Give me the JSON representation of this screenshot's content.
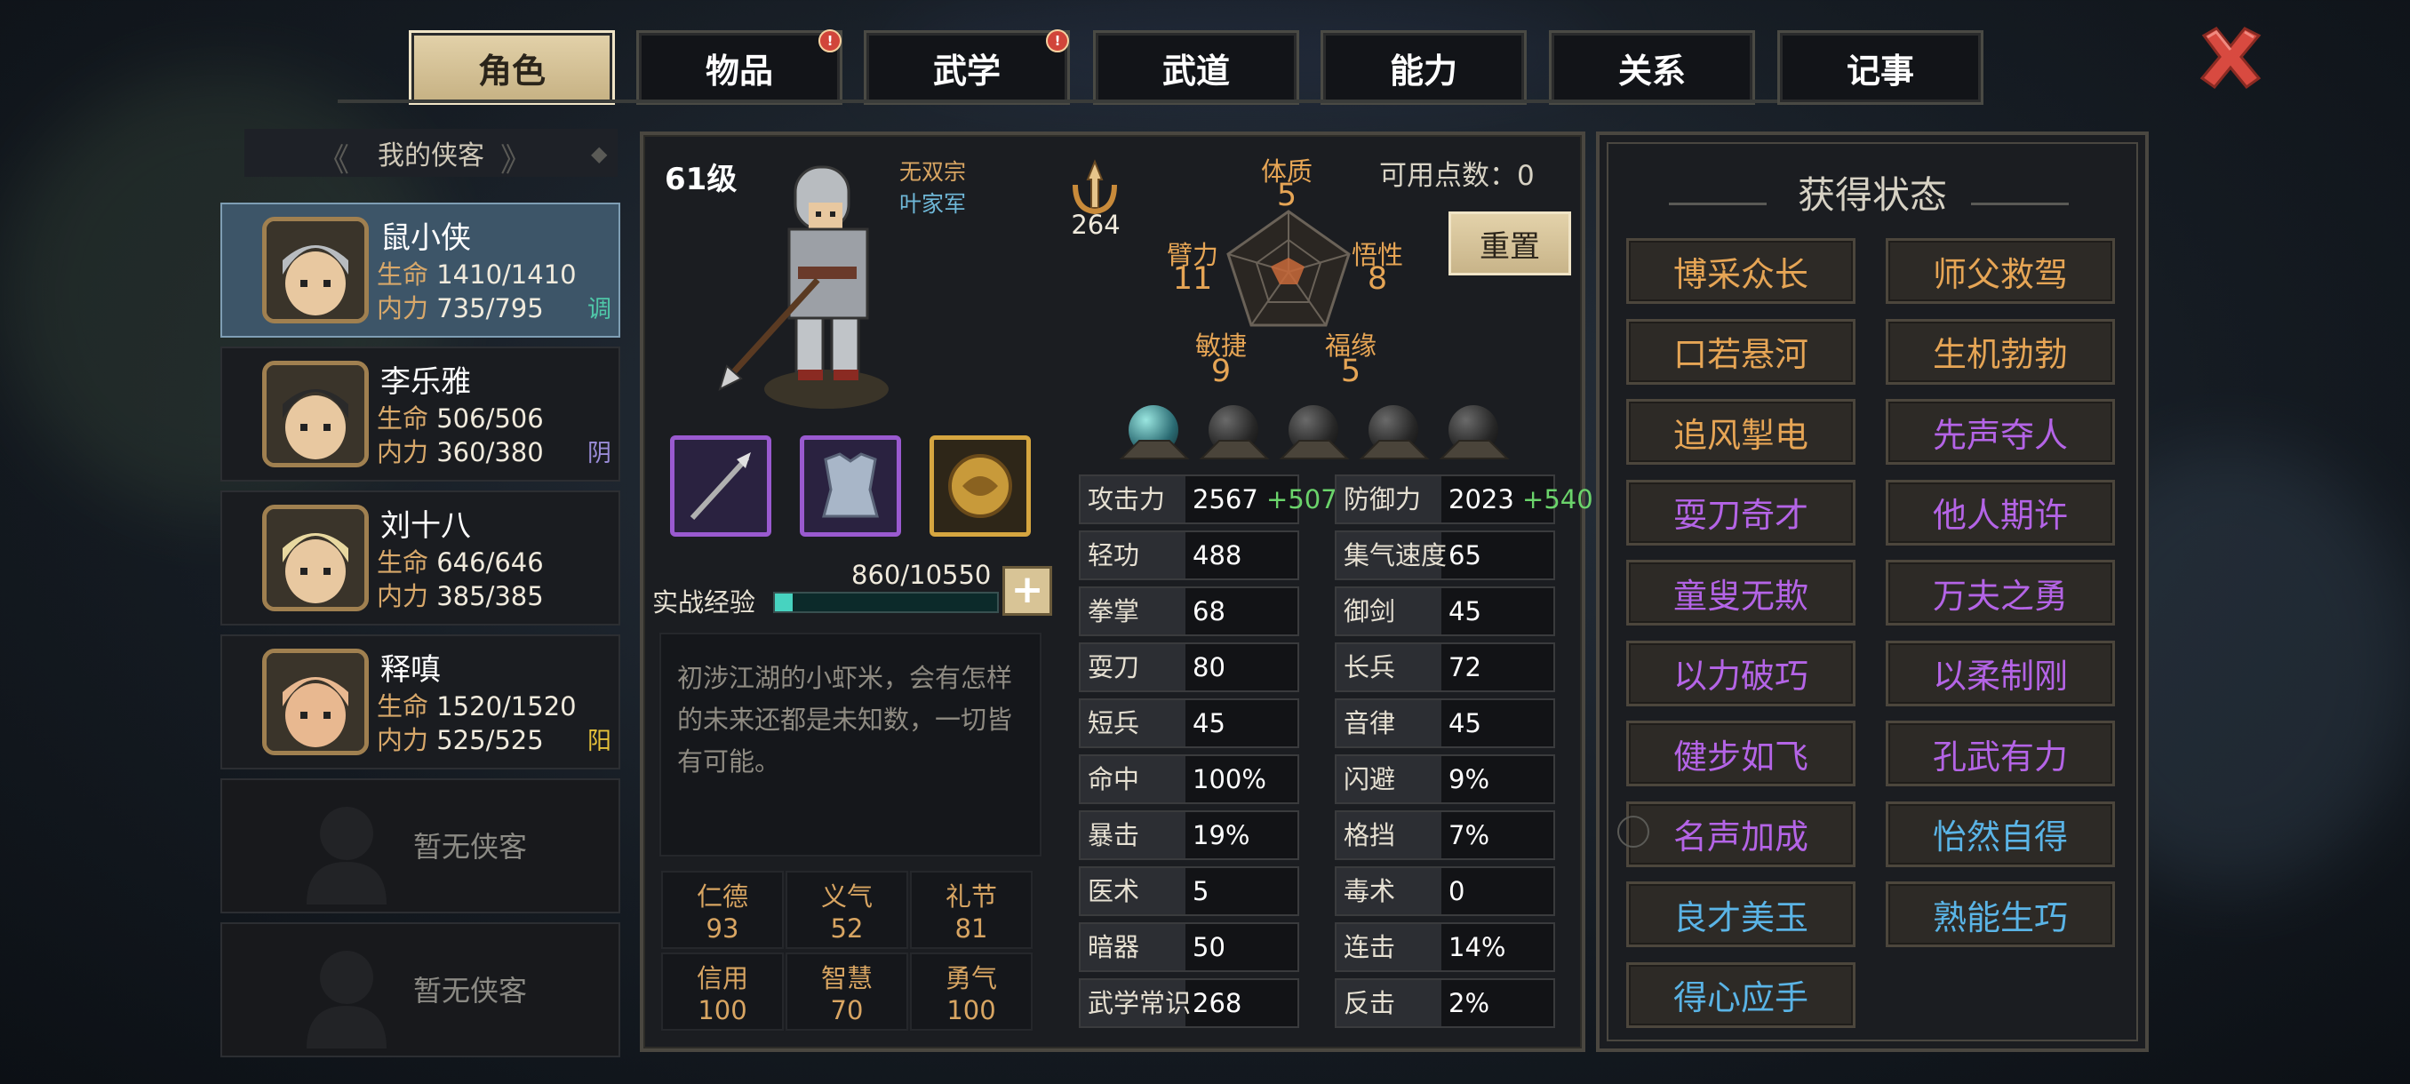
{
  "tabs": [
    {
      "label": "角色",
      "active": true,
      "badge": false
    },
    {
      "label": "物品",
      "active": false,
      "badge": true
    },
    {
      "label": "武学",
      "active": false,
      "badge": true
    },
    {
      "label": "武道",
      "active": false,
      "badge": false
    },
    {
      "label": "能力",
      "active": false,
      "badge": false
    },
    {
      "label": "关系",
      "active": false,
      "badge": false
    },
    {
      "label": "记事",
      "active": false,
      "badge": false
    }
  ],
  "badge_glyph": "!",
  "list_title": "我的侠客",
  "heroes": [
    {
      "name": "鼠小侠",
      "hp_label": "生命",
      "hp": "1410/1410",
      "mp_label": "内力",
      "mp": "735/795",
      "tag": "调",
      "tag_color": "#4fc7a8"
    },
    {
      "name": "李乐雅",
      "hp_label": "生命",
      "hp": "506/506",
      "mp_label": "内力",
      "mp": "360/380",
      "tag": "阴",
      "tag_color": "#9a8cd8"
    },
    {
      "name": "刘十八",
      "hp_label": "生命",
      "hp": "646/646",
      "mp_label": "内力",
      "mp": "385/385",
      "tag": "",
      "tag_color": "#ffffff"
    },
    {
      "name": "释嗔",
      "hp_label": "生命",
      "hp": "1520/1520",
      "mp_label": "内力",
      "mp": "525/525",
      "tag": "阳",
      "tag_color": "#e6c23a"
    }
  ],
  "empty_slots": [
    "暂无侠客",
    "暂无侠客"
  ],
  "character": {
    "level": "61级",
    "sect": "无双宗",
    "army": "叶家军",
    "power": "264",
    "available_points": "可用点数：0",
    "reset_label": "重置",
    "attributes": {
      "tizhi": {
        "name": "体质",
        "value": "5"
      },
      "bili": {
        "name": "臂力",
        "value": "11"
      },
      "wuxing": {
        "name": "悟性",
        "value": "8"
      },
      "minjie": {
        "name": "敏捷",
        "value": "9"
      },
      "fuyuan": {
        "name": "福缘",
        "value": "5"
      }
    },
    "exp_label": "实战经验",
    "exp_value": "860/10550",
    "exp_fraction": 0.0815,
    "exp_plus": "+",
    "description": "初涉江湖的小虾米，会有怎样的未来还都是未知数，一切皆有可能。",
    "virtues": [
      {
        "name": "仁德",
        "value": "93"
      },
      {
        "name": "义气",
        "value": "52"
      },
      {
        "name": "礼节",
        "value": "81"
      },
      {
        "name": "信用",
        "value": "100"
      },
      {
        "name": "智慧",
        "value": "70"
      },
      {
        "name": "勇气",
        "value": "100"
      }
    ]
  },
  "stats": [
    {
      "name": "攻击力",
      "value": "2567",
      "bonus": "+507"
    },
    {
      "name": "防御力",
      "value": "2023",
      "bonus": "+540"
    },
    {
      "name": "轻功",
      "value": "488",
      "bonus": ""
    },
    {
      "name": "集气速度",
      "value": "65",
      "bonus": ""
    },
    {
      "name": "拳掌",
      "value": "68",
      "bonus": ""
    },
    {
      "name": "御剑",
      "value": "45",
      "bonus": ""
    },
    {
      "name": "耍刀",
      "value": "80",
      "bonus": ""
    },
    {
      "name": "长兵",
      "value": "72",
      "bonus": ""
    },
    {
      "name": "短兵",
      "value": "45",
      "bonus": ""
    },
    {
      "name": "音律",
      "value": "45",
      "bonus": ""
    },
    {
      "name": "命中",
      "value": "100%",
      "bonus": ""
    },
    {
      "name": "闪避",
      "value": "9%",
      "bonus": ""
    },
    {
      "name": "暴击",
      "value": "19%",
      "bonus": ""
    },
    {
      "name": "格挡",
      "value": "7%",
      "bonus": ""
    },
    {
      "name": "医术",
      "value": "5",
      "bonus": ""
    },
    {
      "name": "毒术",
      "value": "0",
      "bonus": ""
    },
    {
      "name": "暗器",
      "value": "50",
      "bonus": ""
    },
    {
      "name": "连击",
      "value": "14%",
      "bonus": ""
    },
    {
      "name": "武学常识",
      "value": "268",
      "bonus": ""
    },
    {
      "name": "反击",
      "value": "2%",
      "bonus": ""
    }
  ],
  "status_title": "获得状态",
  "statuses": [
    {
      "label": "博采众长",
      "color": "#e6a555"
    },
    {
      "label": "师父救驾",
      "color": "#e6a555"
    },
    {
      "label": "口若悬河",
      "color": "#e6a555"
    },
    {
      "label": "生机勃勃",
      "color": "#e6a555"
    },
    {
      "label": "追风掣电",
      "color": "#e6a555"
    },
    {
      "label": "先声夺人",
      "color": "#b464e6"
    },
    {
      "label": "耍刀奇才",
      "color": "#b464e6"
    },
    {
      "label": "他人期许",
      "color": "#b464e6"
    },
    {
      "label": "童叟无欺",
      "color": "#b464e6"
    },
    {
      "label": "万夫之勇",
      "color": "#b464e6"
    },
    {
      "label": "以力破巧",
      "color": "#b464e6"
    },
    {
      "label": "以柔制刚",
      "color": "#b464e6"
    },
    {
      "label": "健步如飞",
      "color": "#b464e6"
    },
    {
      "label": "孔武有力",
      "color": "#b464e6"
    },
    {
      "label": "名声加成",
      "color": "#b464e6"
    },
    {
      "label": "怡然自得",
      "color": "#5ab4e6"
    },
    {
      "label": "良才美玉",
      "color": "#5ab4e6"
    },
    {
      "label": "熟能生巧",
      "color": "#5ab4e6"
    },
    {
      "label": "得心应手",
      "color": "#5ab4e6"
    }
  ],
  "colors": {
    "accent_gold": "#d8c496",
    "active_tab": "#e3d2aa",
    "selected_card": "#3d5568",
    "bonus_green": "#6bd46b",
    "badge_red": "#d1453a",
    "close_red": "#d84a40"
  }
}
